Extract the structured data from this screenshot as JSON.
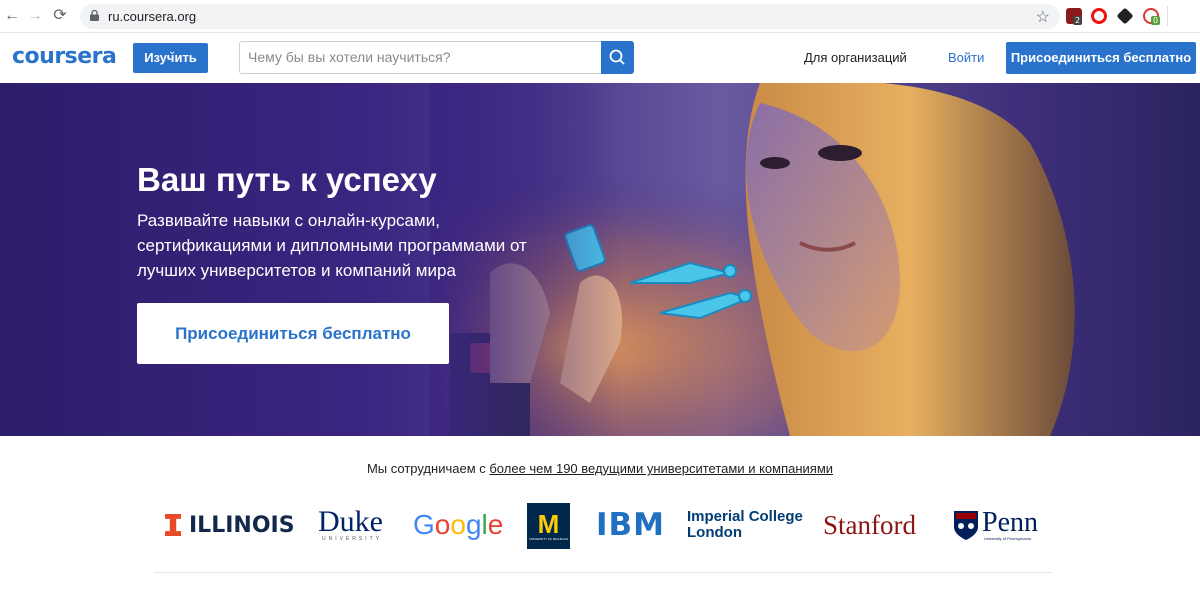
{
  "browser": {
    "url": "ru.coursera.org",
    "extension_badges": [
      "2",
      "0"
    ]
  },
  "header": {
    "logo": "coursera",
    "explore_label": "Изучить",
    "search_placeholder": "Чему бы вы хотели научиться?",
    "for_business": "Для организаций",
    "login": "Войти",
    "join_free": "Присоединиться бесплатно"
  },
  "hero": {
    "title": "Ваш путь к успеху",
    "subtitle": "Развивайте навыки с онлайн-курсами, сертификациями и дипломными программами от лучших университетов и компаний мира",
    "cta": "Присоединиться бесплатно"
  },
  "partners": {
    "intro": "Мы сотрудничаем с ",
    "link": "более чем 190 ведущими университетами и компаниями",
    "logos": {
      "illinois": "ILLINOIS",
      "illinois_mark": "I",
      "duke": "Duke",
      "duke_sub": "UNIVERSITY",
      "google": [
        "G",
        "o",
        "o",
        "g",
        "l",
        "e"
      ],
      "michigan": "M",
      "michigan_sub": "UNIVERSITY OF MICHIGAN",
      "ibm": "IBM",
      "imperial_line1": "Imperial College",
      "imperial_line2": "London",
      "stanford": "Stanford",
      "penn": "Penn",
      "penn_sub": "University of Pennsylvania"
    }
  },
  "colors": {
    "brand": "#2a73cc",
    "hero_bg": "#2d1d6b",
    "illinois_orange": "#e84a27",
    "illinois_blue": "#13294b",
    "duke_blue": "#012169",
    "michigan_blue": "#00274c",
    "michigan_maize": "#ffcb05",
    "ibm_blue": "#1f70c1",
    "imperial_blue": "#003e74",
    "stanford_red": "#8c1515",
    "penn_blue": "#011f5b"
  }
}
